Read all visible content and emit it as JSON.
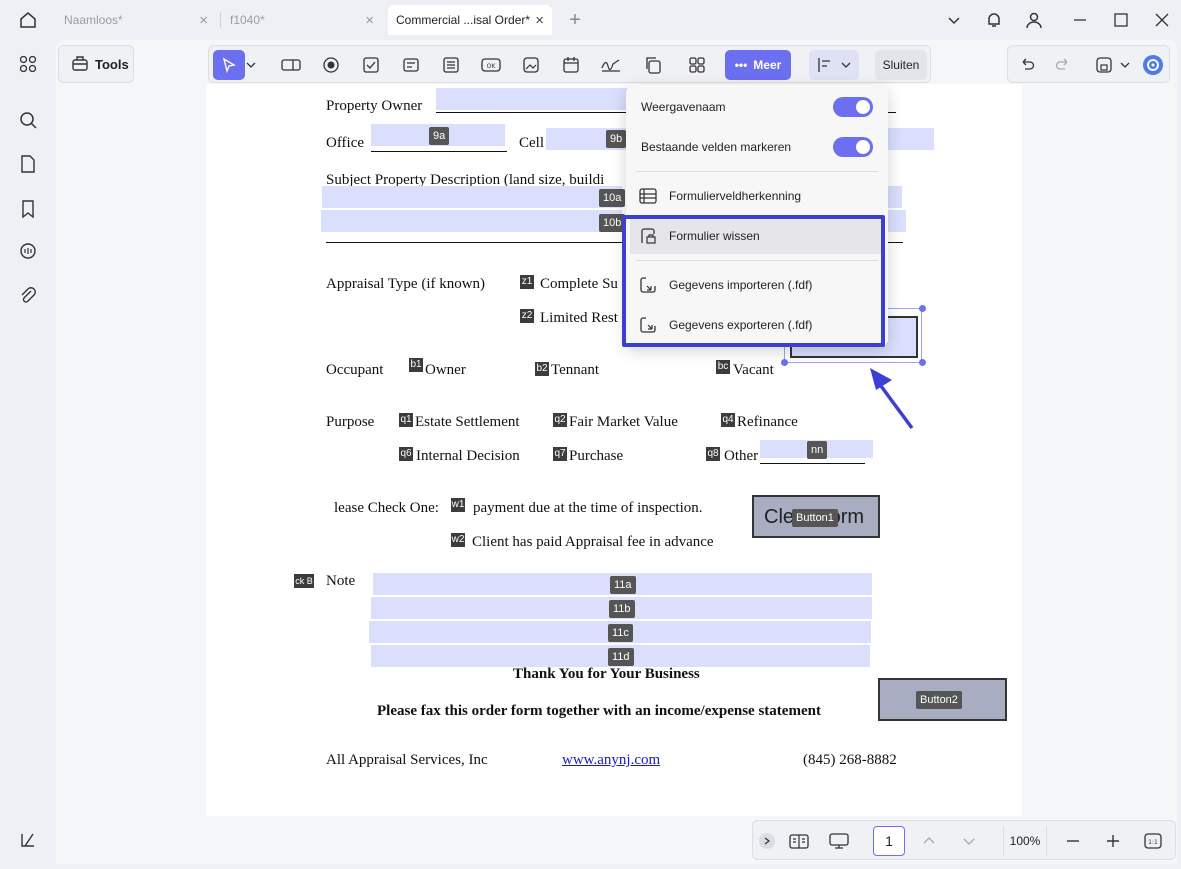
{
  "tabs": [
    {
      "label": "Naamloos*"
    },
    {
      "label": "f1040*"
    },
    {
      "label": "Commercial ...isal Order*"
    }
  ],
  "tools_label": "Tools",
  "toolbar": {
    "meer_label": "Meer",
    "close_label": "Sluiten"
  },
  "form": {
    "property_owner": "Property Owner",
    "office": "Office",
    "cell": "Cell",
    "subject_desc": "Subject Property Description (land size, buildi",
    "appraisal_type": "Appraisal Type (if known)",
    "complete": "Complete Su",
    "limited": "Limited Rest",
    "occupant": "Occupant",
    "owner": "Owner",
    "tennant": "Tennant",
    "vacant": "Vacant",
    "purpose": "Purpose",
    "estate": "Estate Settlement",
    "fair_market": "Fair Market Value",
    "refinance": "Refinance",
    "internal": "Internal Decision",
    "purchase": "Purchase",
    "other": "Other",
    "please_check": "lease Check One:",
    "payment_due": "payment due at the time of inspection.",
    "client_paid": "Client has paid Appraisal fee in advance",
    "clear_form": "Clear Form",
    "note": "Note",
    "ckb": "ck B",
    "thank_you": "Thank You for Your Business",
    "fax": "Please fax this order form together with an income/expense statement",
    "company": "All Appraisal Services, Inc",
    "website": "www.anynj.com",
    "phone": "(845) 268-8882",
    "tags": {
      "f9a": "9a",
      "f9b": "9b",
      "f10a": "10a",
      "f10b": "10b",
      "z1": "z1",
      "z2": "z2",
      "b1": "b1",
      "b2": "b2",
      "bc": "bc",
      "q1": "q1",
      "q2": "q2",
      "q4": "q4",
      "q6": "q6",
      "q7": "q7",
      "q8": "q8",
      "nn": "nn",
      "w1": "w1",
      "w2": "w2",
      "f11a": "11a",
      "f11b": "11b",
      "f11c": "11c",
      "f11d": "11d",
      "button1": "Button1",
      "button2": "Button2"
    }
  },
  "menu": {
    "display_name": "Weergavenaam",
    "mark_fields": "Bestaande velden markeren",
    "recognition": "Formulierveldherkenning",
    "clear": "Formulier wissen",
    "import": "Gegevens importeren (.fdf)",
    "export": "Gegevens exporteren (.fdf)"
  },
  "bottombar": {
    "page": "1",
    "zoom": "100%"
  },
  "colors": {
    "accent": "#6b6ff0",
    "field": "#d9dffc",
    "highlight": "#3d3fd0"
  }
}
